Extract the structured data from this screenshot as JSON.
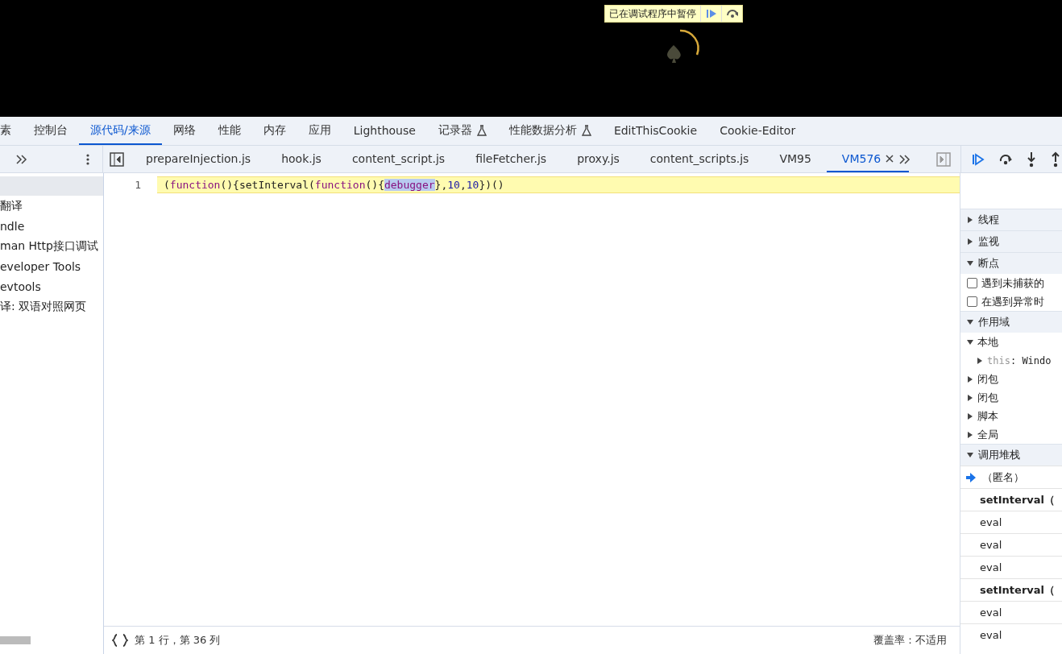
{
  "page": {
    "paused_label": "已在调试程序中暂停"
  },
  "panel_tabs": [
    {
      "label": "素",
      "selected": false,
      "experimental": false
    },
    {
      "label": "控制台",
      "selected": false,
      "experimental": false
    },
    {
      "label": "源代码/来源",
      "selected": true,
      "experimental": false
    },
    {
      "label": "网络",
      "selected": false,
      "experimental": false
    },
    {
      "label": "性能",
      "selected": false,
      "experimental": false
    },
    {
      "label": "内存",
      "selected": false,
      "experimental": false
    },
    {
      "label": "应用",
      "selected": false,
      "experimental": false
    },
    {
      "label": "Lighthouse",
      "selected": false,
      "experimental": false
    },
    {
      "label": "记录器",
      "selected": false,
      "experimental": true
    },
    {
      "label": "性能数据分析",
      "selected": false,
      "experimental": true
    },
    {
      "label": "EditThisCookie",
      "selected": false,
      "experimental": false
    },
    {
      "label": "Cookie-Editor",
      "selected": false,
      "experimental": false
    }
  ],
  "file_tabs": [
    {
      "label": "prepareInjection.js",
      "selected": false
    },
    {
      "label": "hook.js",
      "selected": false
    },
    {
      "label": "content_script.js",
      "selected": false
    },
    {
      "label": "fileFetcher.js",
      "selected": false
    },
    {
      "label": "proxy.js",
      "selected": false
    },
    {
      "label": "content_scripts.js",
      "selected": false
    },
    {
      "label": "VM95",
      "selected": false
    },
    {
      "label": "VM576",
      "selected": true
    }
  ],
  "navigator": {
    "items": [
      "翻译",
      "ndle",
      "man Http接口调试",
      "eveloper Tools",
      "evtools",
      "译: 双语对照网页"
    ]
  },
  "editor": {
    "line_number": "1",
    "paused_line": true,
    "tokens": [
      {
        "text": "(",
        "kind": "punct",
        "selected": false
      },
      {
        "text": "function",
        "kind": "keyword",
        "selected": false
      },
      {
        "text": "(){setInterval(",
        "kind": "punct",
        "selected": false
      },
      {
        "text": "function",
        "kind": "keyword",
        "selected": false
      },
      {
        "text": "(){",
        "kind": "punct",
        "selected": false
      },
      {
        "text": "debugger",
        "kind": "keyword",
        "selected": true
      },
      {
        "text": "},",
        "kind": "punct",
        "selected": false
      },
      {
        "text": "10",
        "kind": "number",
        "selected": false
      },
      {
        "text": ",",
        "kind": "punct",
        "selected": false
      },
      {
        "text": "10",
        "kind": "number",
        "selected": false
      },
      {
        "text": "})()",
        "kind": "punct",
        "selected": false
      }
    ]
  },
  "status_bar": {
    "position": "第 1 行，第 36 列",
    "coverage": "覆盖率：不适用"
  },
  "debugger_sidebar": {
    "sections": [
      {
        "title": "线程",
        "expanded": false
      },
      {
        "title": "监视",
        "expanded": false
      },
      {
        "title": "断点",
        "expanded": true,
        "checkboxes": [
          {
            "label": "遇到未捕获的",
            "checked": false
          },
          {
            "label": "在遇到异常时",
            "checked": false
          }
        ]
      },
      {
        "title": "作用域",
        "expanded": true,
        "scopes": [
          {
            "label": "本地",
            "expanded": true,
            "children": [
              {
                "key": "this",
                "separator": ":",
                "value": "Windo"
              }
            ]
          },
          {
            "label": "闭包",
            "expanded": false
          },
          {
            "label": "闭包",
            "expanded": false
          },
          {
            "label": "脚本",
            "expanded": false
          },
          {
            "label": "全局",
            "expanded": false
          }
        ]
      },
      {
        "title": "调用堆栈",
        "expanded": true,
        "frames": [
          {
            "label": "（匿名）",
            "kind": "current"
          },
          {
            "label": "setInterval（",
            "kind": "async"
          },
          {
            "label": "eval",
            "kind": "frame"
          },
          {
            "label": "eval",
            "kind": "frame"
          },
          {
            "label": "eval",
            "kind": "frame"
          },
          {
            "label": "setInterval（",
            "kind": "async"
          },
          {
            "label": "eval",
            "kind": "frame"
          },
          {
            "label": "eval",
            "kind": "frame"
          }
        ]
      }
    ]
  }
}
